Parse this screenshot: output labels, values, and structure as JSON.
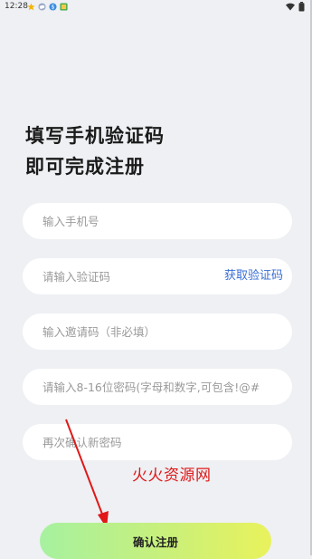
{
  "status_bar": {
    "time": "12:28",
    "notif_icons": [
      "star-icon",
      "cloud-icon",
      "app-icon",
      "image-icon"
    ],
    "right_icons": [
      "wifi-icon",
      "battery-icon"
    ]
  },
  "headline": {
    "line1": "填写手机验证码",
    "line2": "即可完成注册"
  },
  "form": {
    "phone": {
      "value": "",
      "placeholder": "输入手机号"
    },
    "code": {
      "value": "",
      "placeholder": "请输入验证码",
      "get_code_label": "获取验证码"
    },
    "invite": {
      "value": "",
      "placeholder": "输入邀请码（非必填）"
    },
    "password": {
      "value": "",
      "placeholder": "请输入8-16位密码(字母和数字,可包含!@#"
    },
    "confirm": {
      "value": "",
      "placeholder": "再次确认新密码"
    }
  },
  "register_button": {
    "label": "确认注册"
  },
  "watermark": "火火资源网",
  "colors": {
    "background": "#eef0f3",
    "accent_link": "#3a6fd6",
    "button_gradient": [
      "#a6f1a0",
      "#c9f07a",
      "#e9f25c"
    ],
    "annotation": "#e01818"
  }
}
